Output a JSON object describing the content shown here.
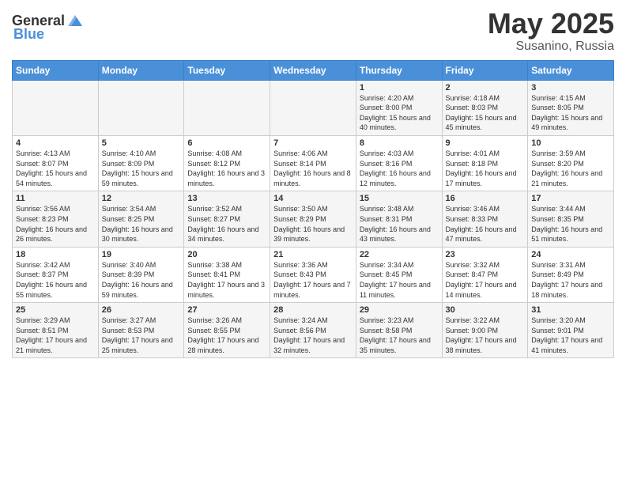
{
  "header": {
    "logo_general": "General",
    "logo_blue": "Blue",
    "title": "May 2025",
    "location": "Susanino, Russia"
  },
  "weekdays": [
    "Sunday",
    "Monday",
    "Tuesday",
    "Wednesday",
    "Thursday",
    "Friday",
    "Saturday"
  ],
  "weeks": [
    [
      {
        "day": "",
        "sunrise": "",
        "sunset": "",
        "daylight": ""
      },
      {
        "day": "",
        "sunrise": "",
        "sunset": "",
        "daylight": ""
      },
      {
        "day": "",
        "sunrise": "",
        "sunset": "",
        "daylight": ""
      },
      {
        "day": "",
        "sunrise": "",
        "sunset": "",
        "daylight": ""
      },
      {
        "day": "1",
        "sunrise": "Sunrise: 4:20 AM",
        "sunset": "Sunset: 8:00 PM",
        "daylight": "Daylight: 15 hours and 40 minutes."
      },
      {
        "day": "2",
        "sunrise": "Sunrise: 4:18 AM",
        "sunset": "Sunset: 8:03 PM",
        "daylight": "Daylight: 15 hours and 45 minutes."
      },
      {
        "day": "3",
        "sunrise": "Sunrise: 4:15 AM",
        "sunset": "Sunset: 8:05 PM",
        "daylight": "Daylight: 15 hours and 49 minutes."
      }
    ],
    [
      {
        "day": "4",
        "sunrise": "Sunrise: 4:13 AM",
        "sunset": "Sunset: 8:07 PM",
        "daylight": "Daylight: 15 hours and 54 minutes."
      },
      {
        "day": "5",
        "sunrise": "Sunrise: 4:10 AM",
        "sunset": "Sunset: 8:09 PM",
        "daylight": "Daylight: 15 hours and 59 minutes."
      },
      {
        "day": "6",
        "sunrise": "Sunrise: 4:08 AM",
        "sunset": "Sunset: 8:12 PM",
        "daylight": "Daylight: 16 hours and 3 minutes."
      },
      {
        "day": "7",
        "sunrise": "Sunrise: 4:06 AM",
        "sunset": "Sunset: 8:14 PM",
        "daylight": "Daylight: 16 hours and 8 minutes."
      },
      {
        "day": "8",
        "sunrise": "Sunrise: 4:03 AM",
        "sunset": "Sunset: 8:16 PM",
        "daylight": "Daylight: 16 hours and 12 minutes."
      },
      {
        "day": "9",
        "sunrise": "Sunrise: 4:01 AM",
        "sunset": "Sunset: 8:18 PM",
        "daylight": "Daylight: 16 hours and 17 minutes."
      },
      {
        "day": "10",
        "sunrise": "Sunrise: 3:59 AM",
        "sunset": "Sunset: 8:20 PM",
        "daylight": "Daylight: 16 hours and 21 minutes."
      }
    ],
    [
      {
        "day": "11",
        "sunrise": "Sunrise: 3:56 AM",
        "sunset": "Sunset: 8:23 PM",
        "daylight": "Daylight: 16 hours and 26 minutes."
      },
      {
        "day": "12",
        "sunrise": "Sunrise: 3:54 AM",
        "sunset": "Sunset: 8:25 PM",
        "daylight": "Daylight: 16 hours and 30 minutes."
      },
      {
        "day": "13",
        "sunrise": "Sunrise: 3:52 AM",
        "sunset": "Sunset: 8:27 PM",
        "daylight": "Daylight: 16 hours and 34 minutes."
      },
      {
        "day": "14",
        "sunrise": "Sunrise: 3:50 AM",
        "sunset": "Sunset: 8:29 PM",
        "daylight": "Daylight: 16 hours and 39 minutes."
      },
      {
        "day": "15",
        "sunrise": "Sunrise: 3:48 AM",
        "sunset": "Sunset: 8:31 PM",
        "daylight": "Daylight: 16 hours and 43 minutes."
      },
      {
        "day": "16",
        "sunrise": "Sunrise: 3:46 AM",
        "sunset": "Sunset: 8:33 PM",
        "daylight": "Daylight: 16 hours and 47 minutes."
      },
      {
        "day": "17",
        "sunrise": "Sunrise: 3:44 AM",
        "sunset": "Sunset: 8:35 PM",
        "daylight": "Daylight: 16 hours and 51 minutes."
      }
    ],
    [
      {
        "day": "18",
        "sunrise": "Sunrise: 3:42 AM",
        "sunset": "Sunset: 8:37 PM",
        "daylight": "Daylight: 16 hours and 55 minutes."
      },
      {
        "day": "19",
        "sunrise": "Sunrise: 3:40 AM",
        "sunset": "Sunset: 8:39 PM",
        "daylight": "Daylight: 16 hours and 59 minutes."
      },
      {
        "day": "20",
        "sunrise": "Sunrise: 3:38 AM",
        "sunset": "Sunset: 8:41 PM",
        "daylight": "Daylight: 17 hours and 3 minutes."
      },
      {
        "day": "21",
        "sunrise": "Sunrise: 3:36 AM",
        "sunset": "Sunset: 8:43 PM",
        "daylight": "Daylight: 17 hours and 7 minutes."
      },
      {
        "day": "22",
        "sunrise": "Sunrise: 3:34 AM",
        "sunset": "Sunset: 8:45 PM",
        "daylight": "Daylight: 17 hours and 11 minutes."
      },
      {
        "day": "23",
        "sunrise": "Sunrise: 3:32 AM",
        "sunset": "Sunset: 8:47 PM",
        "daylight": "Daylight: 17 hours and 14 minutes."
      },
      {
        "day": "24",
        "sunrise": "Sunrise: 3:31 AM",
        "sunset": "Sunset: 8:49 PM",
        "daylight": "Daylight: 17 hours and 18 minutes."
      }
    ],
    [
      {
        "day": "25",
        "sunrise": "Sunrise: 3:29 AM",
        "sunset": "Sunset: 8:51 PM",
        "daylight": "Daylight: 17 hours and 21 minutes."
      },
      {
        "day": "26",
        "sunrise": "Sunrise: 3:27 AM",
        "sunset": "Sunset: 8:53 PM",
        "daylight": "Daylight: 17 hours and 25 minutes."
      },
      {
        "day": "27",
        "sunrise": "Sunrise: 3:26 AM",
        "sunset": "Sunset: 8:55 PM",
        "daylight": "Daylight: 17 hours and 28 minutes."
      },
      {
        "day": "28",
        "sunrise": "Sunrise: 3:24 AM",
        "sunset": "Sunset: 8:56 PM",
        "daylight": "Daylight: 17 hours and 32 minutes."
      },
      {
        "day": "29",
        "sunrise": "Sunrise: 3:23 AM",
        "sunset": "Sunset: 8:58 PM",
        "daylight": "Daylight: 17 hours and 35 minutes."
      },
      {
        "day": "30",
        "sunrise": "Sunrise: 3:22 AM",
        "sunset": "Sunset: 9:00 PM",
        "daylight": "Daylight: 17 hours and 38 minutes."
      },
      {
        "day": "31",
        "sunrise": "Sunrise: 3:20 AM",
        "sunset": "Sunset: 9:01 PM",
        "daylight": "Daylight: 17 hours and 41 minutes."
      }
    ]
  ]
}
